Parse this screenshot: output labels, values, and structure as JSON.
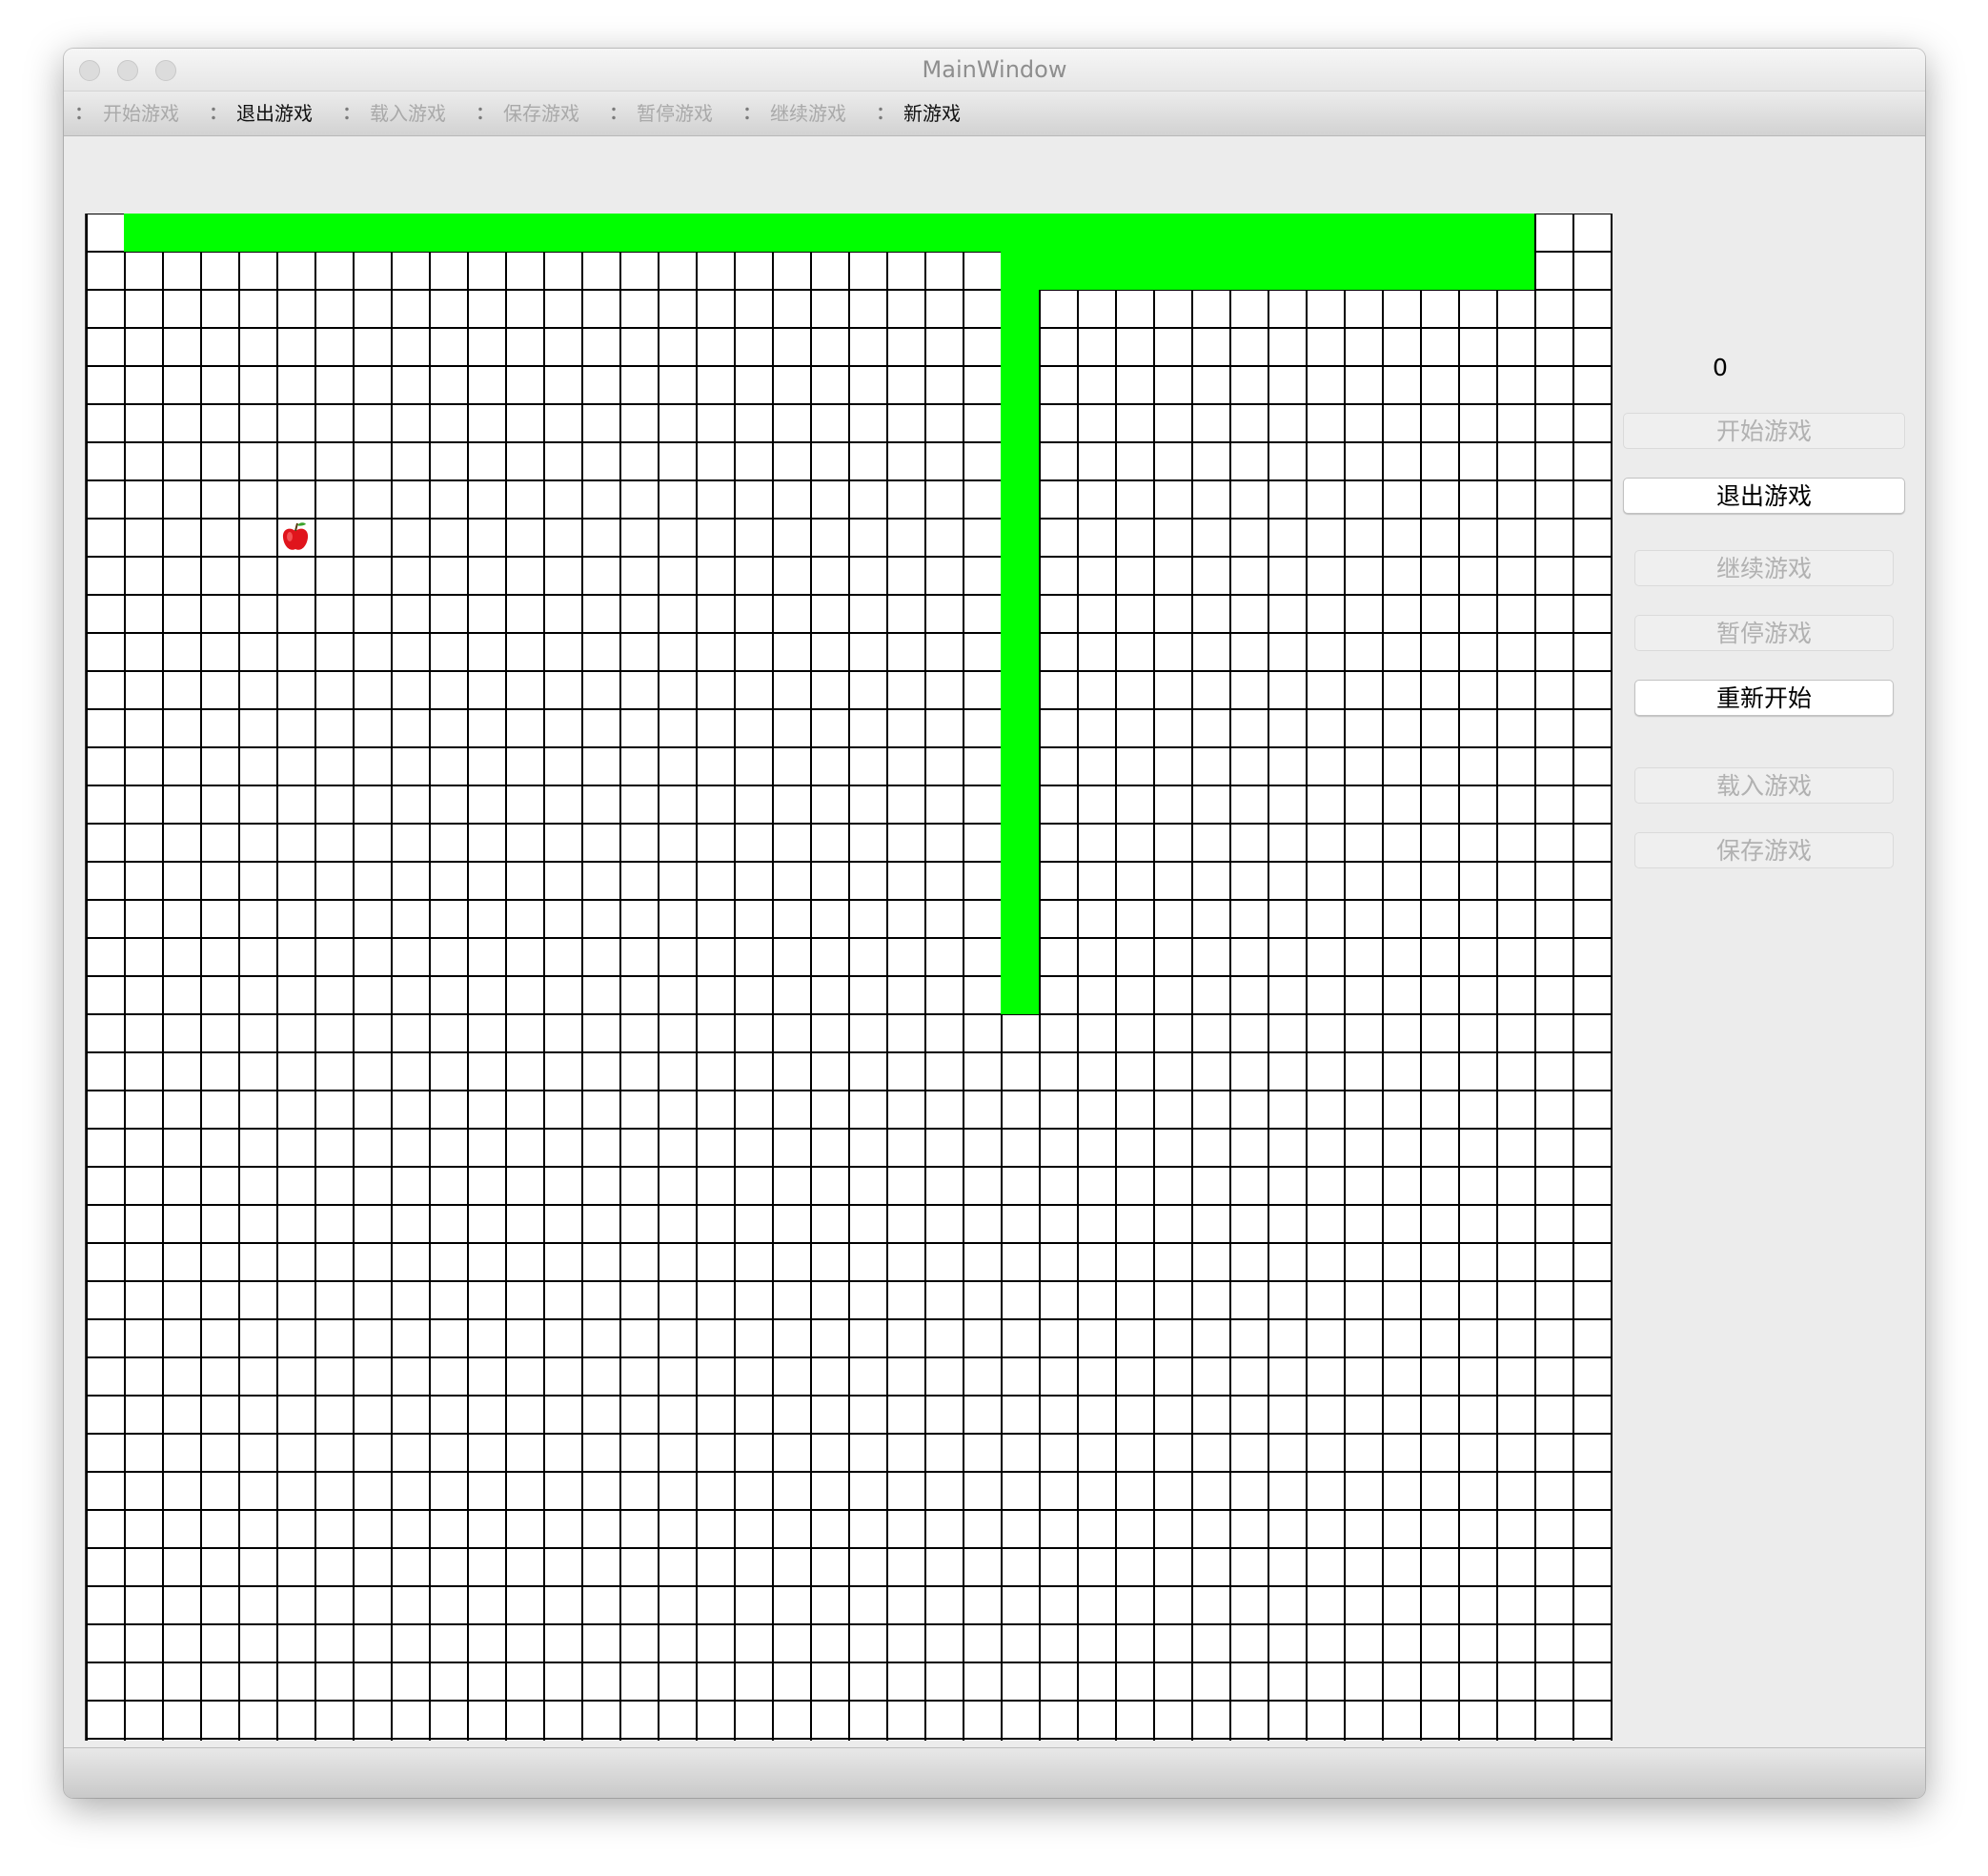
{
  "window": {
    "title": "MainWindow"
  },
  "toolbar": {
    "items": [
      {
        "label": "开始游戏",
        "enabled": false
      },
      {
        "label": "退出游戏",
        "enabled": true
      },
      {
        "label": "载入游戏",
        "enabled": false
      },
      {
        "label": "保存游戏",
        "enabled": false
      },
      {
        "label": "暂停游戏",
        "enabled": false
      },
      {
        "label": "继续游戏",
        "enabled": false
      },
      {
        "label": "新游戏",
        "enabled": true
      }
    ]
  },
  "game": {
    "score": "0",
    "grid_columns": 40,
    "grid_rows": 40,
    "snake_color": "#00ff00",
    "grid_line_color": "#000000",
    "snake_cells": [
      {
        "col_start": 1,
        "row_start": 0,
        "cols": 37,
        "rows": 1
      },
      {
        "col_start": 24,
        "row_start": 1,
        "cols": 14,
        "rows": 1
      },
      {
        "col_start": 24,
        "row_start": 2,
        "cols": 1,
        "rows": 19
      }
    ],
    "apple": {
      "col": 5,
      "row": 8,
      "icon": "apple-icon",
      "color": "#e0141c"
    }
  },
  "side_panel": {
    "buttons": [
      {
        "label": "开始游戏",
        "enabled": false,
        "name": "start-game-button"
      },
      {
        "label": "退出游戏",
        "enabled": true,
        "name": "quit-game-button"
      },
      {
        "label": "继续游戏",
        "enabled": false,
        "name": "continue-game-button"
      },
      {
        "label": "暂停游戏",
        "enabled": false,
        "name": "pause-game-button"
      },
      {
        "label": "重新开始",
        "enabled": true,
        "name": "restart-button"
      },
      {
        "label": "载入游戏",
        "enabled": false,
        "name": "load-game-button"
      },
      {
        "label": "保存游戏",
        "enabled": false,
        "name": "save-game-button"
      }
    ]
  }
}
